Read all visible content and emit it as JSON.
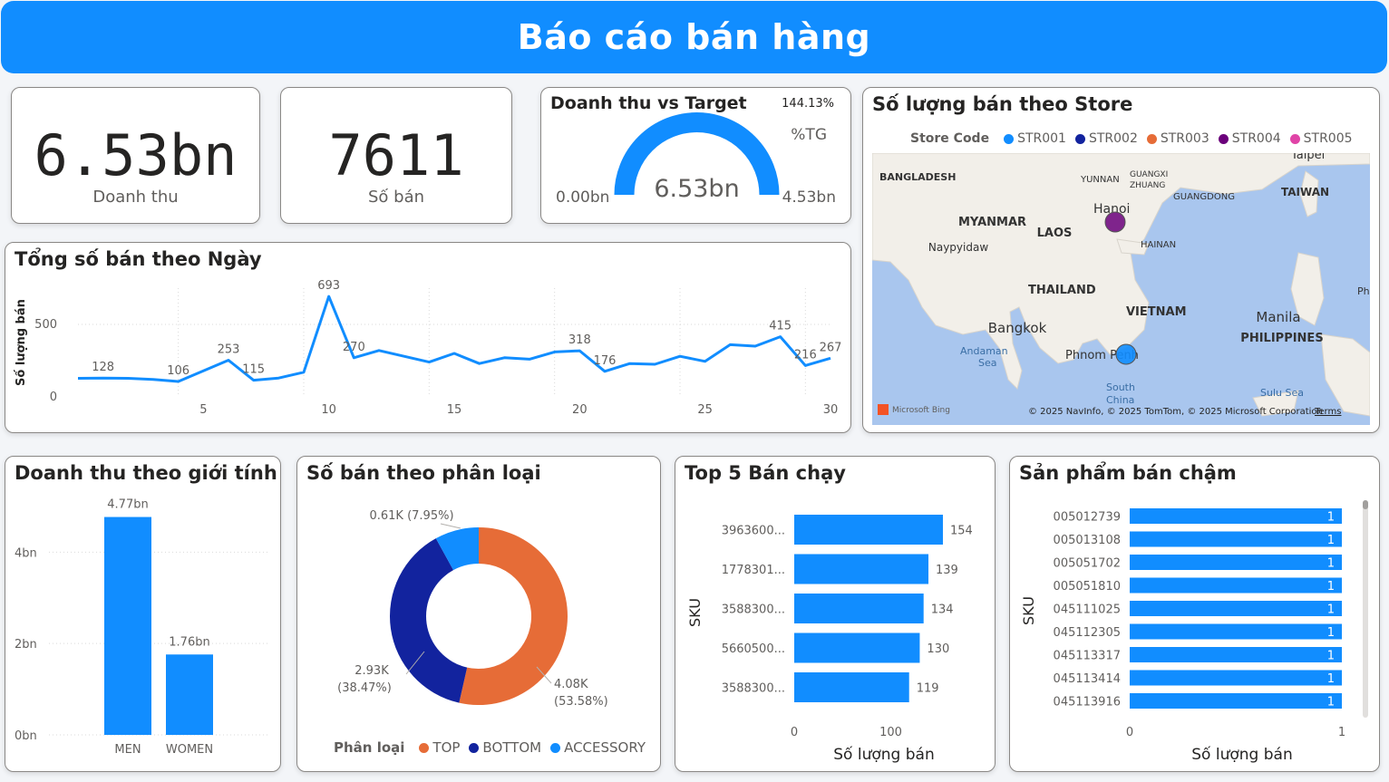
{
  "header": {
    "title": "Báo cáo bán hàng"
  },
  "kpi_revenue": {
    "value": "6.53bn",
    "label": "Doanh thu"
  },
  "kpi_sales": {
    "value": "7611",
    "label": "Số bán"
  },
  "gauge": {
    "title": "Doanh thu vs Target",
    "percent_text": "144.13%",
    "percent_label": "%TG",
    "min_text": "0.00bn",
    "max_text": "4.53bn",
    "value_text": "6.53bn",
    "fill_fraction": 1.0,
    "fill_color": "#118dff"
  },
  "store_map": {
    "title": "Số lượng bán theo Store",
    "legend_title": "Store Code",
    "legend": [
      {
        "name": "STR001",
        "color": "#118dff"
      },
      {
        "name": "STR002",
        "color": "#12239e"
      },
      {
        "name": "STR003",
        "color": "#e66c37"
      },
      {
        "name": "STR004",
        "color": "#6b007b"
      },
      {
        "name": "STR005",
        "color": "#e044a7"
      }
    ],
    "places": [
      "BANGLADESH",
      "YUNNAN",
      "GUANGXI",
      "ZHUANG",
      "GUANGDONG",
      "Taipei",
      "TAIWAN",
      "MYANMAR",
      "Naypyidaw",
      "LAOS",
      "Hanoi",
      "HAINAN",
      "THAILAND",
      "Bangkok",
      "VIETNAM",
      "Manila",
      "PHILIPPINES",
      "Andaman",
      "Sea",
      "Phnom Penh",
      "South",
      "China",
      "Sulu Sea",
      "Ph"
    ],
    "attribution": "© 2025 NavInfo, © 2025 TomTom, © 2025 Microsoft Corporation",
    "terms": "Terms",
    "brand": "Microsoft Bing"
  },
  "daily": {
    "title": "Tổng số bán theo Ngày",
    "ylabel": "Số lượng bán"
  },
  "gender": {
    "title": "Doanh thu theo giới tính"
  },
  "category": {
    "title": "Số bán theo phân loại",
    "legend_title": "Phân loại"
  },
  "top5": {
    "title": "Top 5 Bán chạy",
    "ylabel": "SKU",
    "xlabel": "Số lượng bán"
  },
  "slow": {
    "title": "Sản phẩm bán chậm",
    "ylabel": "SKU",
    "xlabel": "Số lượng bán"
  },
  "chart_data": [
    {
      "id": "daily",
      "type": "line",
      "x": [
        1,
        2,
        3,
        4,
        5,
        6,
        7,
        8,
        9,
        10,
        11,
        12,
        13,
        14,
        15,
        16,
        17,
        18,
        19,
        20,
        21,
        22,
        23,
        24,
        25,
        26,
        27,
        28,
        29,
        30
      ],
      "series": [
        {
          "values": [
            128,
            130,
            128,
            120,
            106,
            180,
            253,
            115,
            130,
            170,
            693,
            270,
            320,
            280,
            240,
            300,
            230,
            270,
            260,
            310,
            318,
            176,
            230,
            225,
            280,
            245,
            360,
            350,
            415,
            216,
            267
          ]
        }
      ],
      "labels": [
        {
          "x": 1,
          "text": "128"
        },
        {
          "x": 4,
          "text": "106"
        },
        {
          "x": 6,
          "text": "253"
        },
        {
          "x": 7,
          "text": "115"
        },
        {
          "x": 10,
          "text": "693"
        },
        {
          "x": 11,
          "text": "270"
        },
        {
          "x": 20,
          "text": "318"
        },
        {
          "x": 21,
          "text": "176"
        },
        {
          "x": 28,
          "text": "415"
        },
        {
          "x": 29,
          "text": "216"
        },
        {
          "x": 30,
          "text": "267"
        }
      ],
      "xticks": [
        "5",
        "10",
        "15",
        "20",
        "25",
        "30"
      ],
      "yticks": [
        "0",
        "500"
      ],
      "ylim": [
        0,
        750
      ]
    },
    {
      "id": "gender",
      "type": "bar",
      "categories": [
        "MEN",
        "WOMEN"
      ],
      "values": [
        4.77,
        1.76
      ],
      "data_labels": [
        "4.77bn",
        "1.76bn"
      ],
      "yticks": [
        "0bn",
        "2bn",
        "4bn"
      ],
      "ylim": [
        0,
        4.9
      ]
    },
    {
      "id": "category",
      "type": "pie",
      "slices": [
        {
          "name": "TOP",
          "value": 4.08,
          "label": "4.08K",
          "pct": "(53.58%)",
          "color": "#e66c37"
        },
        {
          "name": "BOTTOM",
          "value": 2.93,
          "label": "2.93K",
          "pct": "(38.47%)",
          "color": "#12239e"
        },
        {
          "name": "ACCESSORY",
          "value": 0.61,
          "label": "0.61K (7.95%)",
          "pct": "",
          "color": "#118dff"
        }
      ]
    },
    {
      "id": "top5",
      "type": "bar",
      "orientation": "horizontal",
      "categories": [
        "3963600...",
        "1778301...",
        "3588300...",
        "5660500...",
        "3588300..."
      ],
      "values": [
        154,
        139,
        134,
        130,
        119
      ],
      "xticks": [
        "0",
        "100"
      ],
      "xlim": [
        0,
        185
      ]
    },
    {
      "id": "slow",
      "type": "bar",
      "orientation": "horizontal",
      "categories": [
        "005012739",
        "005013108",
        "005051702",
        "005051810",
        "045111025",
        "045112305",
        "045113317",
        "045113414",
        "045113916"
      ],
      "values": [
        1,
        1,
        1,
        1,
        1,
        1,
        1,
        1,
        1
      ],
      "xticks": [
        "0",
        "1"
      ],
      "xlim": [
        0,
        1
      ]
    }
  ]
}
